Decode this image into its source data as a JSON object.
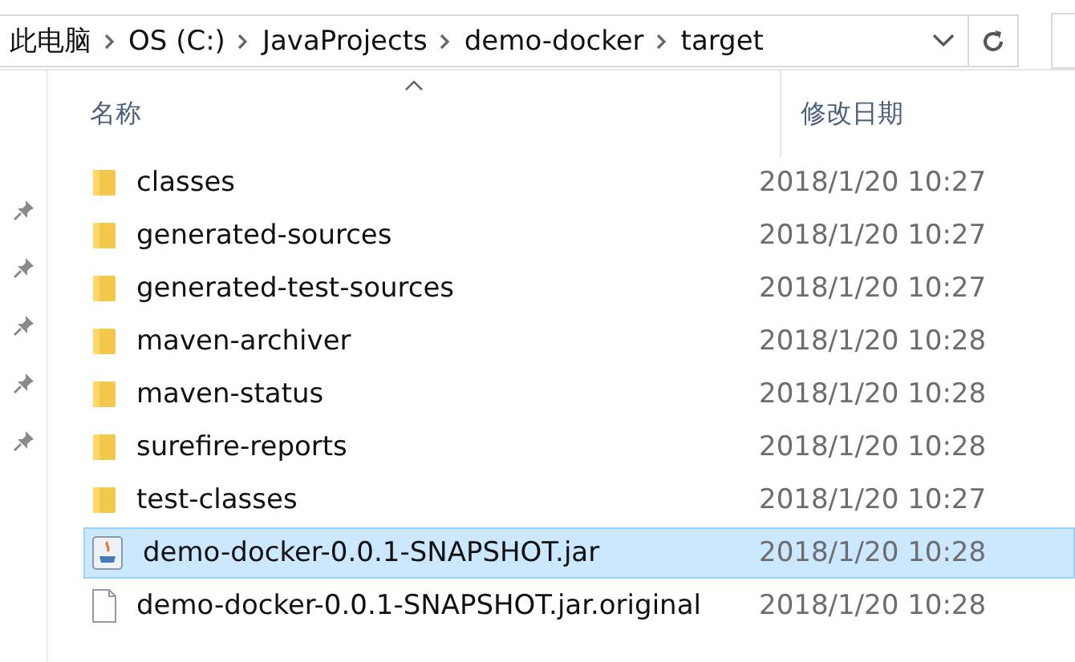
{
  "address_bar": {
    "crumbs": [
      "此电脑",
      "OS (C:)",
      "JavaProjects",
      "demo-docker",
      "target"
    ]
  },
  "columns": [
    {
      "label": "名称",
      "sorted": true
    },
    {
      "label": "修改日期",
      "sorted": false
    }
  ],
  "files": [
    {
      "name": "classes",
      "date": "2018/1/20 10:27",
      "kind": "folder",
      "selected": false
    },
    {
      "name": "generated-sources",
      "date": "2018/1/20 10:27",
      "kind": "folder",
      "selected": false
    },
    {
      "name": "generated-test-sources",
      "date": "2018/1/20 10:27",
      "kind": "folder",
      "selected": false
    },
    {
      "name": "maven-archiver",
      "date": "2018/1/20 10:28",
      "kind": "folder",
      "selected": false
    },
    {
      "name": "maven-status",
      "date": "2018/1/20 10:28",
      "kind": "folder",
      "selected": false
    },
    {
      "name": "surefire-reports",
      "date": "2018/1/20 10:28",
      "kind": "folder",
      "selected": false
    },
    {
      "name": "test-classes",
      "date": "2018/1/20 10:27",
      "kind": "folder",
      "selected": false
    },
    {
      "name": "demo-docker-0.0.1-SNAPSHOT.jar",
      "date": "2018/1/20 10:28",
      "kind": "jar",
      "selected": true
    },
    {
      "name": "demo-docker-0.0.1-SNAPSHOT.jar.original",
      "date": "2018/1/20 10:28",
      "kind": "file",
      "selected": false
    }
  ]
}
